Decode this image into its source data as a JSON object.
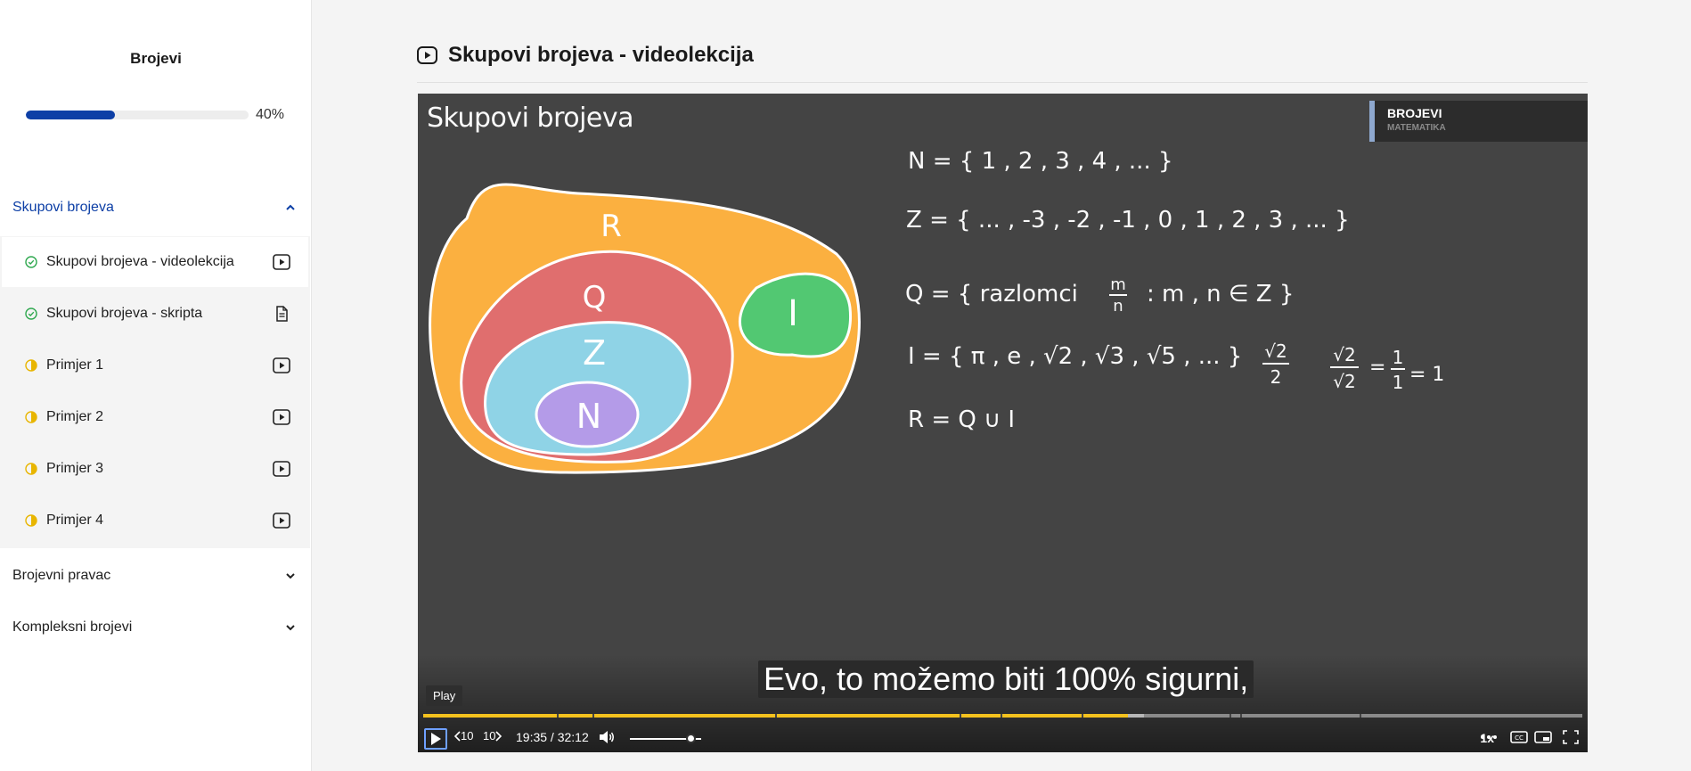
{
  "sidebar": {
    "course_title": "Brojevi",
    "progress_percent": 40,
    "progress_label": "40%",
    "sections": [
      {
        "label": "Skupovi brojeva",
        "expanded": true,
        "lessons": [
          {
            "label": "Skupovi brojeva - videolekcija",
            "status": "completed",
            "type": "video",
            "active": true
          },
          {
            "label": "Skupovi brojeva - skripta",
            "status": "completed",
            "type": "document",
            "active": false
          },
          {
            "label": "Primjer 1",
            "status": "in-progress",
            "type": "video",
            "active": false
          },
          {
            "label": "Primjer 2",
            "status": "in-progress",
            "type": "video",
            "active": false
          },
          {
            "label": "Primjer 3",
            "status": "in-progress",
            "type": "video",
            "active": false
          },
          {
            "label": "Primjer 4",
            "status": "in-progress",
            "type": "video",
            "active": false
          }
        ]
      },
      {
        "label": "Brojevni pravac",
        "expanded": false
      },
      {
        "label": "Kompleksni brojevi",
        "expanded": false
      }
    ]
  },
  "main": {
    "title": "Skupovi brojeva - videolekcija"
  },
  "video": {
    "board_title": "Skupovi brojeva",
    "corner_tag": {
      "title": "BROJEVI",
      "subtitle": "MATEMATIKA"
    },
    "venn_labels": [
      "R",
      "Q",
      "Z",
      "N",
      "I"
    ],
    "formulas": {
      "n": "N = { 1 , 2 , 3 , 4 , ... }",
      "z": "Z = { ... , -3 , -2 , -1 , 0 , 1 , 2 , 3 , ... }",
      "q_left": "Q = { razlomci",
      "q_num": "m",
      "q_den": "n",
      "q_right": ": m , n ∈ Z }",
      "i": "I = { π , e , √2 , √3 , √5 , ... }",
      "frac1_num": "√2",
      "frac1_den": "2",
      "frac2_num": "√2",
      "frac2_den": "√2",
      "frac3_num": "1",
      "frac3_den": "1",
      "eq": "=",
      "eq_one": "= 1",
      "r": "R = Q ∪ I"
    },
    "subtitle": "Evo, to možemo biti 100% sigurni,",
    "tooltip": "Play",
    "current_time": "19:35",
    "duration": "32:12",
    "time_label": "19:35 / 32:12",
    "played_fraction": 0.608,
    "loaded_fraction": 0.622,
    "volume_fraction": 0.85,
    "skip_back_label": "10",
    "skip_forward_label": "10",
    "speed_label": "1x",
    "colors": {
      "accent": "#0d3fa6",
      "played": "#f4c21e",
      "set_r": "#fbb040",
      "set_q": "#e06e6e",
      "set_z": "#8fd3e6",
      "set_n": "#b49be8",
      "set_i": "#52c872",
      "completed": "#2fa84f",
      "in_progress": "#e8b500"
    }
  }
}
